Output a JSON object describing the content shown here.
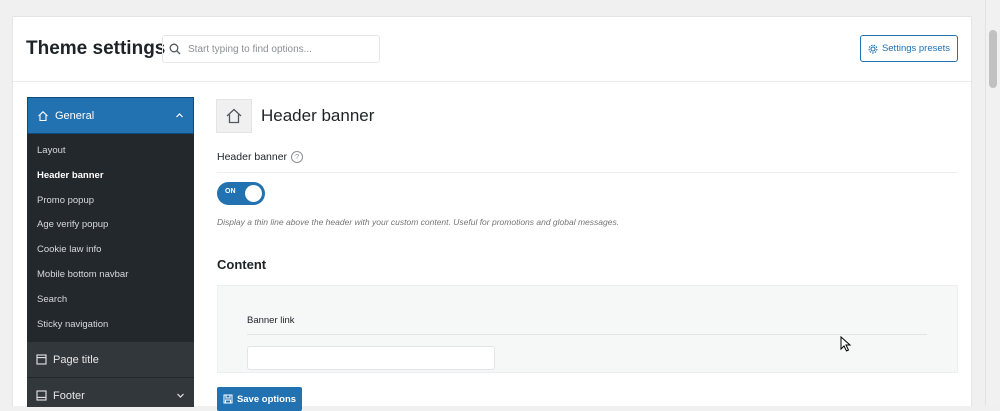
{
  "header": {
    "title": "Theme settings",
    "search": {
      "placeholder": "Start typing to find options..."
    },
    "presets_label": "Settings presets"
  },
  "sidebar": {
    "active_section": "General",
    "sub_items": [
      "Layout",
      "Header banner",
      "Promo popup",
      "Age verify popup",
      "Cookie law info",
      "Mobile bottom navbar",
      "Search",
      "Sticky navigation"
    ],
    "current_item": "Header banner",
    "sections": [
      "Page title",
      "Footer"
    ]
  },
  "main": {
    "section_title": "Header banner",
    "field_label": "Header banner",
    "help_glyph": "?",
    "toggle_text": "ON",
    "toggle_state": true,
    "description": "Display a thin line above the header with your custom content. Useful for promotions and global messages.",
    "content_heading": "Content",
    "banner_link_label": "Banner link",
    "banner_link_value": "",
    "save_label": "Save options"
  },
  "colors": {
    "accent": "#2271b1",
    "sidebar_bg": "#23282d",
    "sidebar_section_bg": "#32373c"
  },
  "icons": [
    "search-icon",
    "gear-icon",
    "home-icon",
    "chevron-up-icon",
    "page-icon",
    "footer-icon",
    "chevron-down-icon",
    "save-icon",
    "help-icon",
    "cursor-icon"
  ]
}
